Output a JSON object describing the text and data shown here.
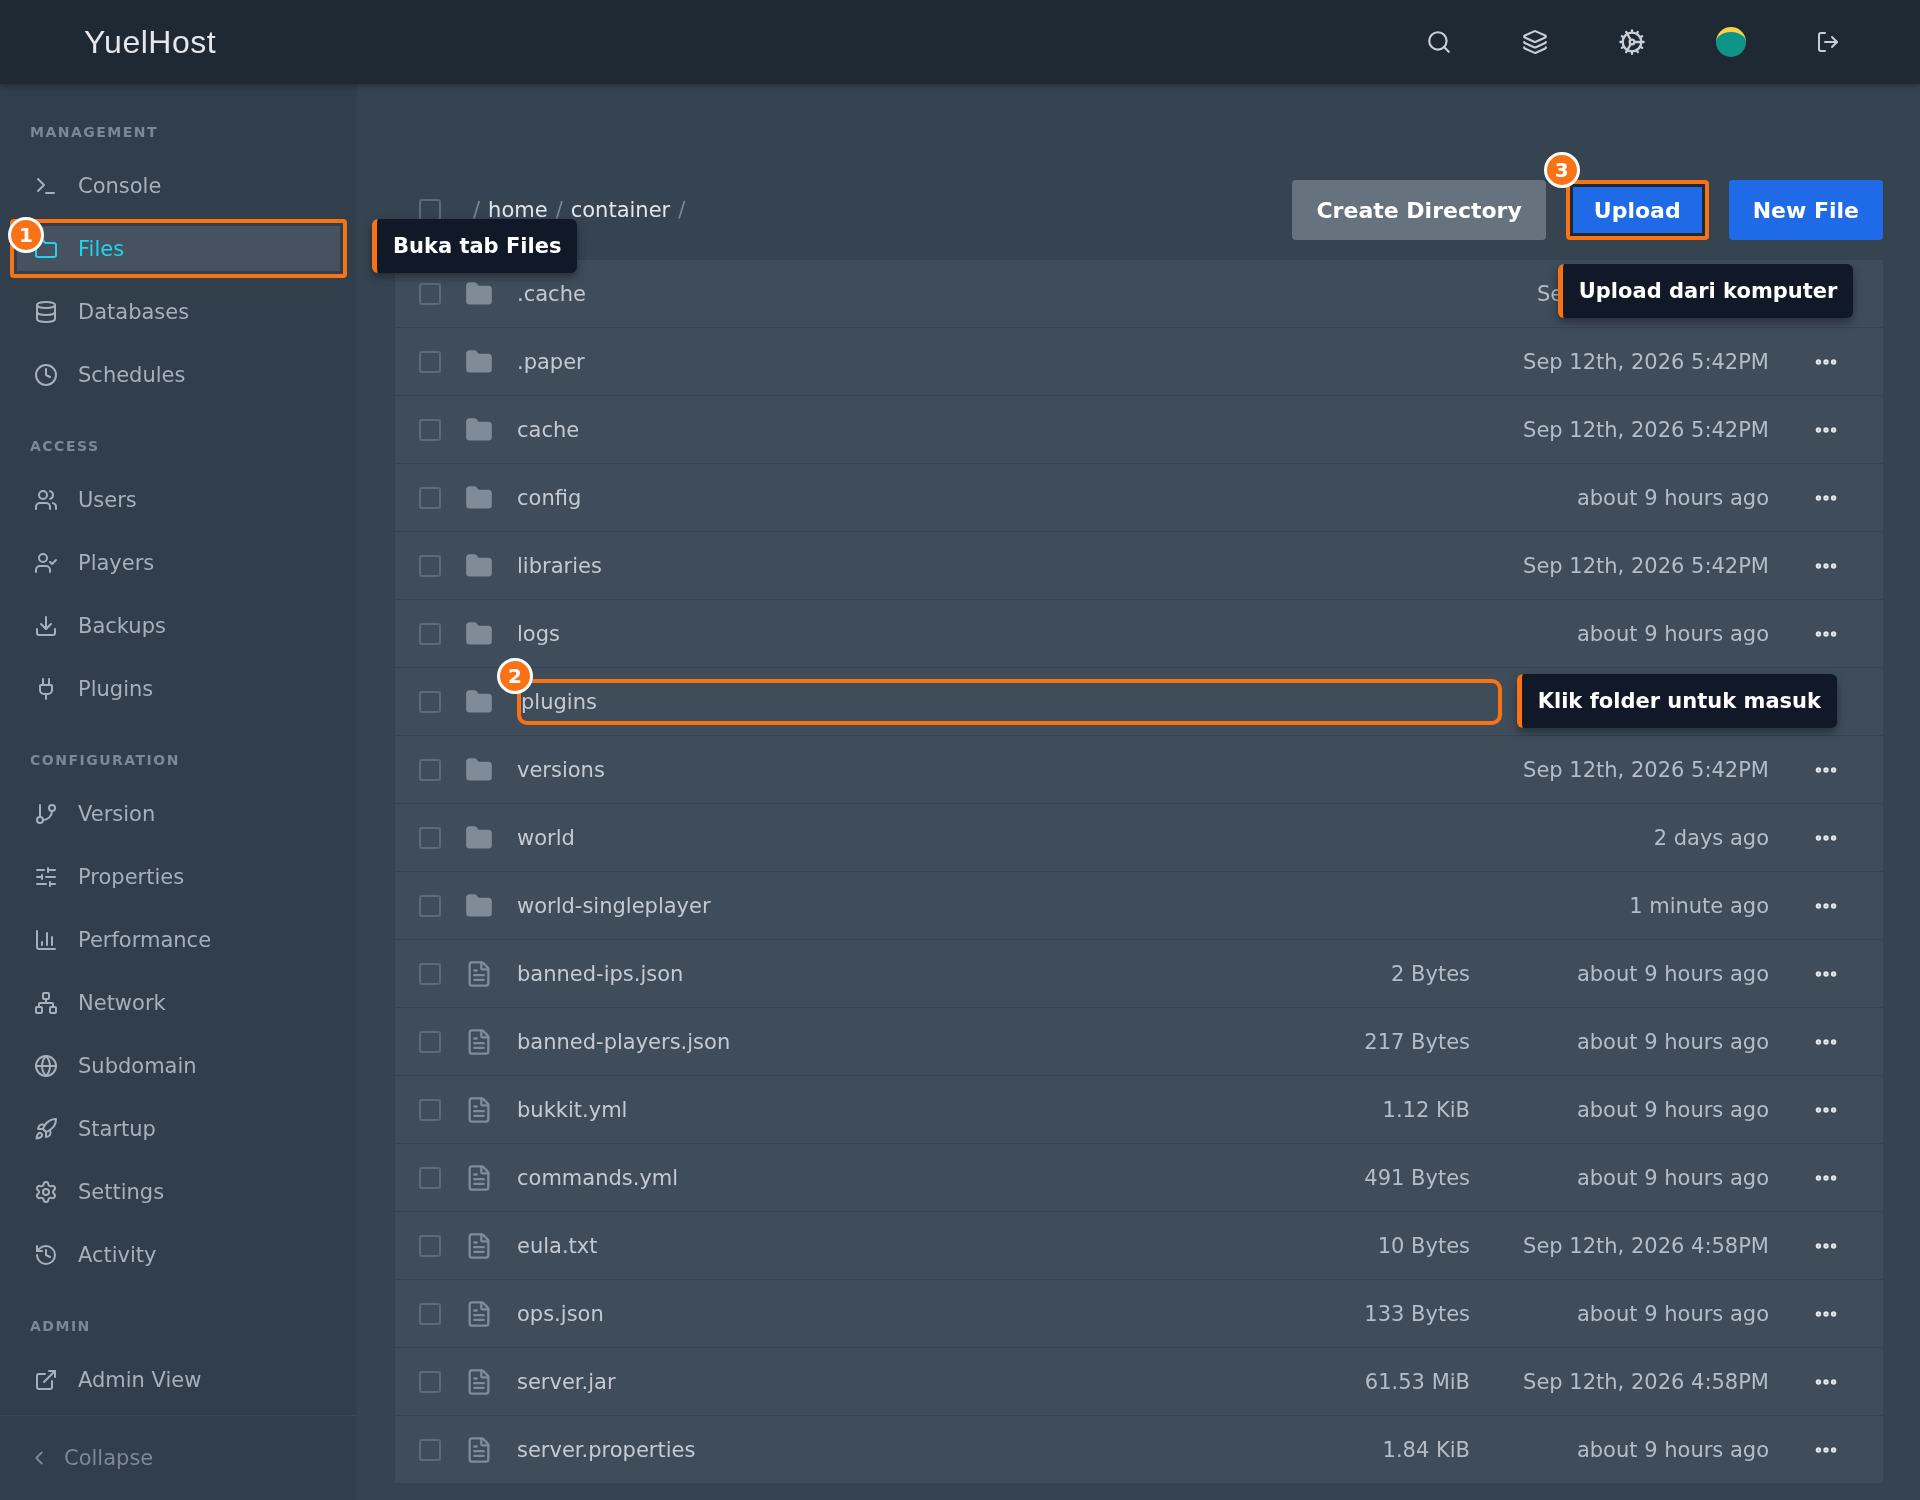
{
  "topbar": {
    "logo": "YuelHost"
  },
  "sidebar": {
    "sections": [
      {
        "title": "MANAGEMENT",
        "items": [
          {
            "label": "Console",
            "selected": false
          },
          {
            "label": "Files",
            "selected": true,
            "callout": {
              "badge": "1",
              "tip": "Buka tab Files"
            }
          },
          {
            "label": "Databases",
            "selected": false
          },
          {
            "label": "Schedules",
            "selected": false
          }
        ]
      },
      {
        "title": "ACCESS",
        "items": [
          {
            "label": "Users",
            "selected": false
          },
          {
            "label": "Players",
            "selected": false
          },
          {
            "label": "Backups",
            "selected": false
          },
          {
            "label": "Plugins",
            "selected": false
          }
        ]
      },
      {
        "title": "CONFIGURATION",
        "items": [
          {
            "label": "Version",
            "selected": false
          },
          {
            "label": "Properties",
            "selected": false
          },
          {
            "label": "Performance",
            "selected": false
          },
          {
            "label": "Network",
            "selected": false
          },
          {
            "label": "Subdomain",
            "selected": false
          },
          {
            "label": "Startup",
            "selected": false
          },
          {
            "label": "Settings",
            "selected": false
          },
          {
            "label": "Activity",
            "selected": false
          }
        ]
      },
      {
        "title": "ADMIN",
        "items": [
          {
            "label": "Admin View",
            "selected": false
          }
        ]
      }
    ],
    "collapse": "Collapse"
  },
  "header": {
    "select_all": {
      "checked": false
    },
    "breadcrumb": [
      {
        "kind": "sep",
        "text": "/"
      },
      {
        "kind": "part",
        "text": "home"
      },
      {
        "kind": "sep",
        "text": "/"
      },
      {
        "kind": "part",
        "text": "container"
      },
      {
        "kind": "sep",
        "text": "/"
      }
    ],
    "buttons": [
      {
        "kind": "secondary",
        "label": "Create Directory"
      },
      {
        "kind": "primary",
        "label": "Upload",
        "callout": {
          "badge": "3",
          "tip": "Upload dari komputer"
        }
      },
      {
        "kind": "primary",
        "label": "New File"
      }
    ]
  },
  "files": [
    {
      "kind": "folder",
      "name": ".cache",
      "date": "Se",
      "date_covered": true,
      "checked": false
    },
    {
      "kind": "folder",
      "name": ".paper",
      "date": "Sep 12th, 2026 5:42PM",
      "checked": false
    },
    {
      "kind": "folder",
      "name": "cache",
      "date": "Sep 12th, 2026 5:42PM",
      "checked": false
    },
    {
      "kind": "folder",
      "name": "config",
      "date": "about 9 hours ago",
      "checked": false
    },
    {
      "kind": "folder",
      "name": "libraries",
      "date": "Sep 12th, 2026 5:42PM",
      "checked": false
    },
    {
      "kind": "folder",
      "name": "logs",
      "date": "about 9 hours ago",
      "checked": false
    },
    {
      "kind": "folder",
      "name": "plugins",
      "checked": false,
      "callout": {
        "badge": "2",
        "tip": "Klik folder untuk masuk"
      }
    },
    {
      "kind": "folder",
      "name": "versions",
      "date": "Sep 12th, 2026 5:42PM",
      "checked": false
    },
    {
      "kind": "folder",
      "name": "world",
      "date": "2 days ago",
      "checked": false
    },
    {
      "kind": "folder",
      "name": "world-singleplayer",
      "date": "1 minute ago",
      "checked": false
    },
    {
      "kind": "file",
      "name": "banned-ips.json",
      "size": "2 Bytes",
      "date": "about 9 hours ago",
      "checked": false
    },
    {
      "kind": "file",
      "name": "banned-players.json",
      "size": "217 Bytes",
      "date": "about 9 hours ago",
      "checked": false
    },
    {
      "kind": "file",
      "name": "bukkit.yml",
      "size": "1.12 KiB",
      "date": "about 9 hours ago",
      "checked": false
    },
    {
      "kind": "file",
      "name": "commands.yml",
      "size": "491 Bytes",
      "date": "about 9 hours ago",
      "checked": false
    },
    {
      "kind": "file",
      "name": "eula.txt",
      "size": "10 Bytes",
      "date": "Sep 12th, 2026 4:58PM",
      "checked": false
    },
    {
      "kind": "file",
      "name": "ops.json",
      "size": "133 Bytes",
      "date": "about 9 hours ago",
      "checked": false
    },
    {
      "kind": "file",
      "name": "server.jar",
      "size": "61.53 MiB",
      "date": "Sep 12th, 2026 4:58PM",
      "checked": false
    },
    {
      "kind": "file",
      "name": "server.properties",
      "size": "1.84 KiB",
      "date": "about 9 hours ago",
      "checked": false
    }
  ]
}
